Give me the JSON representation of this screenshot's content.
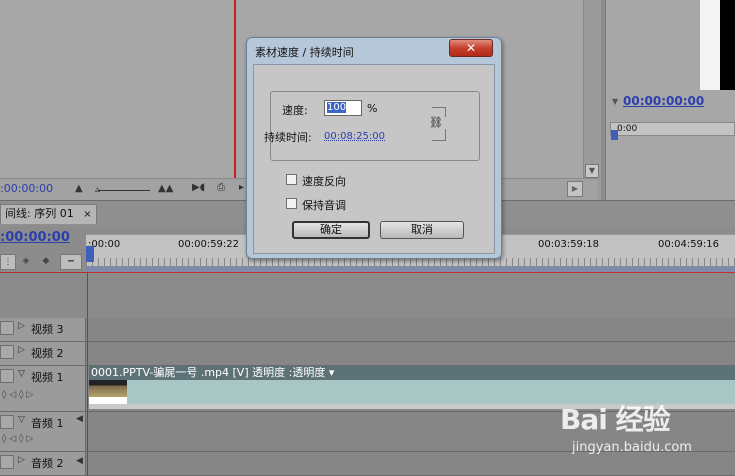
{
  "monitors": {
    "left_timecode": ":00:00:00",
    "right_timecode": "00:00:00:00",
    "right_ruler": "0:00"
  },
  "timeline": {
    "tab_label": "间线: 序列 01",
    "tab_close": "×",
    "timecode": ":00:00:00",
    "ruler_labels": [
      ":00:00",
      "00:00:59:22",
      "00:03:59:18",
      "00:04:59:16"
    ],
    "tracks": [
      {
        "label": "视频 3"
      },
      {
        "label": "视频 2"
      },
      {
        "label": "视频 1"
      },
      {
        "label": "音频 1"
      },
      {
        "label": "音频 2"
      }
    ],
    "clip_title": "0001.PPTV-骗屍一号 .mp4 [V]  透明度 :透明度 ▾"
  },
  "dialog": {
    "title": "素材速度 / 持续时间",
    "close": "✕",
    "speed_label": "速度:",
    "speed_value": "100",
    "percent": "%",
    "duration_label": "持续时间:",
    "duration_value": "00:08:25:00",
    "reverse_label": "速度反向",
    "reverse_checked": false,
    "pitch_label": "保持音调",
    "pitch_checked": false,
    "ok_label": "确定",
    "cancel_label": "取消"
  },
  "watermark": {
    "logo": "Bai 经验",
    "site": "jingyan.baidu.com"
  }
}
